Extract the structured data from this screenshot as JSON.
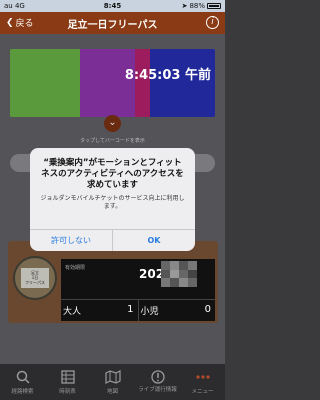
{
  "status_bar": {
    "carrier": "au 4G",
    "time": "8:45",
    "battery": "88%",
    "battery_level": 0.88
  },
  "nav": {
    "back_label": "戻る",
    "title": "足立一日フリーパス",
    "info_icon": "info-icon"
  },
  "ticket": {
    "colors": [
      "#78c850",
      "#a43cc8",
      "#d0247c",
      "#2a36c8"
    ],
    "clock": "8:45:03 午前",
    "tap_hint": "タップしてバーコードを表示"
  },
  "pass": {
    "logo_text": [
      "足立",
      "1日",
      "フリーパス"
    ],
    "validity_label": "有効期限",
    "validity_value": "202",
    "fares": [
      {
        "label": "大人",
        "count": "1"
      },
      {
        "label": "小児",
        "count": "0"
      }
    ]
  },
  "dialog": {
    "title": "“乗換案内”がモーションとフィットネスのアクティビティへのアクセスを求めています",
    "message": "ジョルダンモバイルチケットのサービス向上に利用します。",
    "deny_label": "許可しない",
    "ok_label": "OK"
  },
  "tab_bar": {
    "items": [
      {
        "label": "経路検索",
        "icon": "route-search-icon"
      },
      {
        "label": "時刻表",
        "icon": "timetable-icon"
      },
      {
        "label": "地図",
        "icon": "map-icon"
      },
      {
        "label": "ライブ運行情報",
        "icon": "live-info-icon"
      },
      {
        "label": "メニュー",
        "icon": "menu-icon"
      }
    ]
  }
}
